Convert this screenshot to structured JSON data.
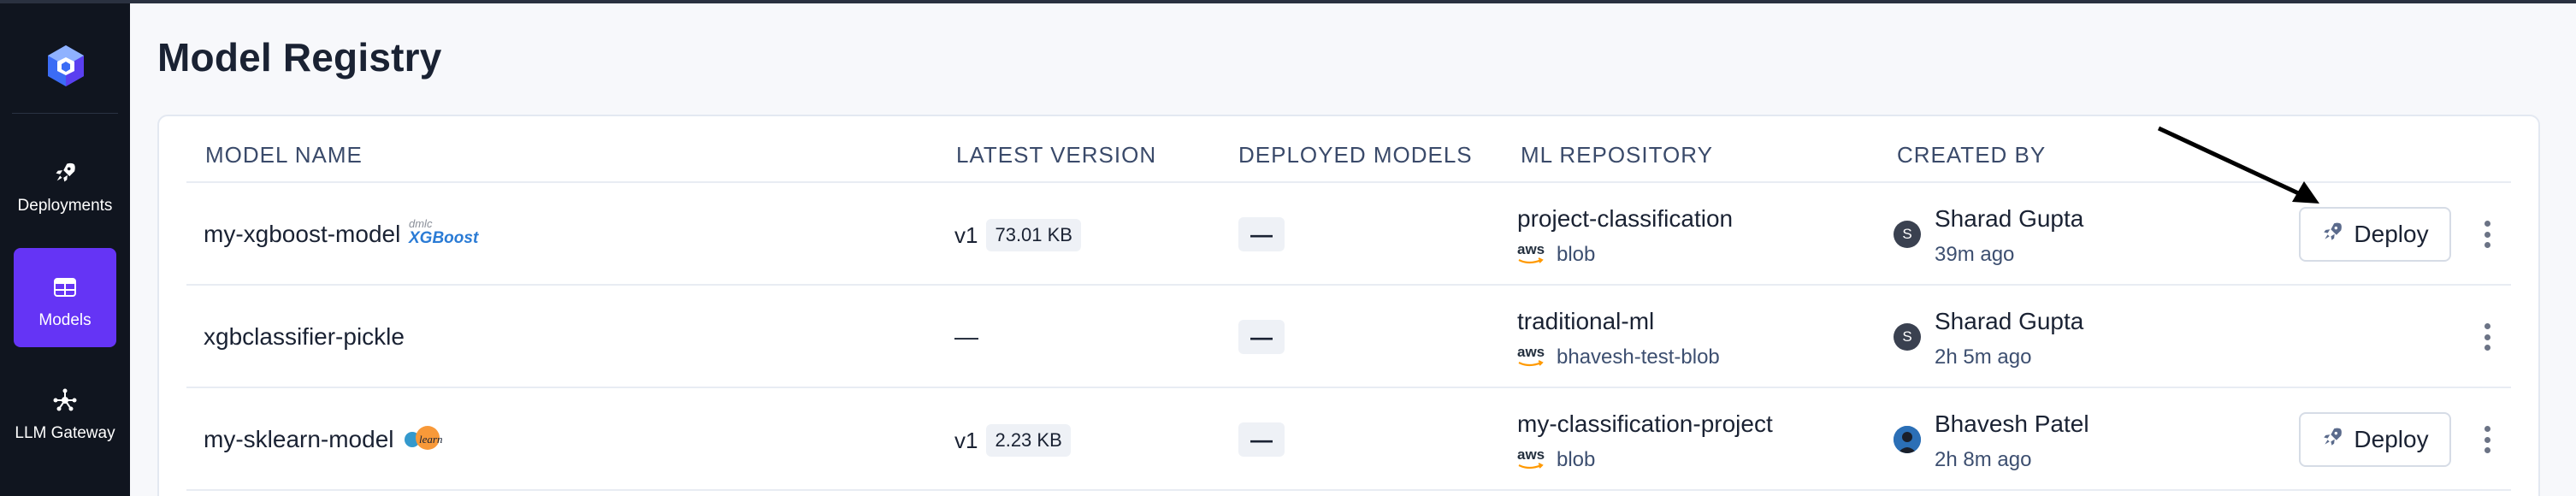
{
  "sidebar": {
    "items": [
      {
        "label": "Deployments",
        "icon": "rocket-icon"
      },
      {
        "label": "Models",
        "icon": "table-icon",
        "active": true
      },
      {
        "label": "LLM Gateway",
        "icon": "network-icon"
      }
    ]
  },
  "header": {
    "title": "Model Registry"
  },
  "table": {
    "columns": [
      "MODEL NAME",
      "LATEST VERSION",
      "DEPLOYED MODELS",
      "ML REPOSITORY",
      "CREATED BY"
    ],
    "rows": [
      {
        "model_name": "my-xgboost-model",
        "framework_badge_top": "dmlc",
        "framework_badge_bottom": "XGBoost",
        "version": "v1",
        "size": "73.01 KB",
        "deployed": "—",
        "repository": "project-classification",
        "storage_provider": "aws",
        "storage": "blob",
        "creator_initial": "S",
        "creator": "Sharad Gupta",
        "created": "39m ago",
        "deploy_label": "Deploy"
      },
      {
        "model_name": "xgbclassifier-pickle",
        "version_placeholder": "—",
        "deployed": "—",
        "repository": "traditional-ml",
        "storage_provider": "aws",
        "storage": "bhavesh-test-blob",
        "creator_initial": "S",
        "creator": "Sharad Gupta",
        "created": "2h 5m ago"
      },
      {
        "model_name": "my-sklearn-model",
        "framework_badge": "learn",
        "version": "v1",
        "size": "2.23 KB",
        "deployed": "—",
        "repository": "my-classification-project",
        "storage_provider": "aws",
        "storage": "blob",
        "creator": "Bhavesh Patel",
        "created": "2h 8m ago",
        "deploy_label": "Deploy"
      }
    ]
  },
  "colors": {
    "sidebar_bg": "#10151f",
    "active_nav": "#6534f5",
    "xgboost_blue": "#2a7bd5"
  }
}
